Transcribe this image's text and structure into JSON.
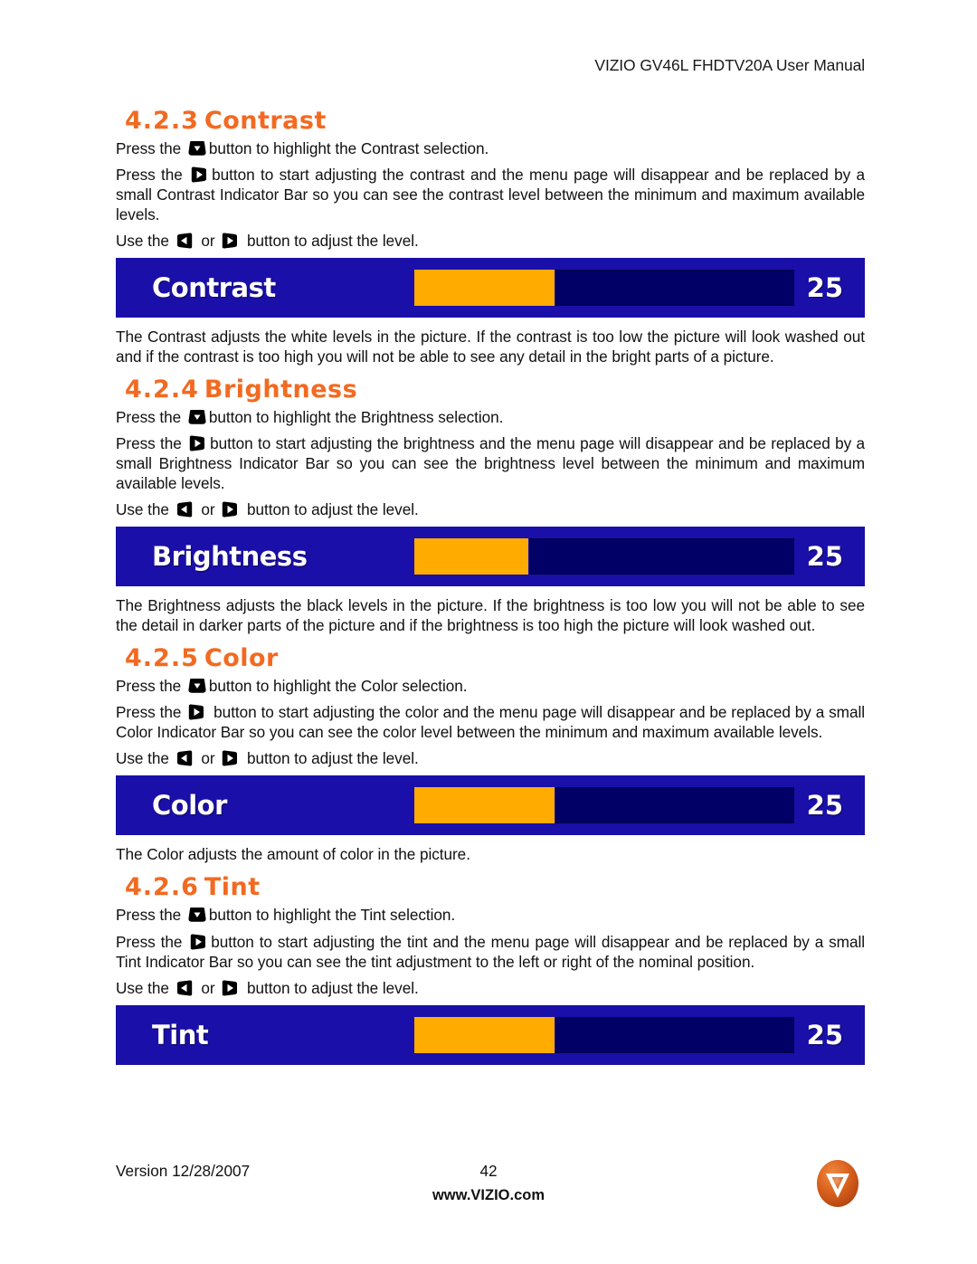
{
  "document": {
    "header": "VIZIO GV46L FHDTV20A User Manual",
    "footer": {
      "version": "Version 12/28/2007",
      "page_number": "42",
      "url": "www.VIZIO.com",
      "logo": "vizio-logo"
    }
  },
  "colors": {
    "heading_orange": "#f26a21",
    "osd_background_blue": "#1a0fa8",
    "osd_track_navy": "#000066",
    "osd_fill_orange": "#ffab00",
    "body_text": "#111111"
  },
  "icons": {
    "down_arrow_key": "down-arrow-button-icon",
    "right_arrow_key": "right-arrow-button-icon",
    "left_arrow_key": "left-arrow-button-icon"
  },
  "sections": [
    {
      "number": "4.2.3",
      "title": "Contrast",
      "paragraphs": [
        {
          "id": "highlight",
          "parts": [
            "Press the ",
            "button to highlight the Contrast selection."
          ],
          "icon": "down-arrow-button-icon",
          "justify": false
        },
        {
          "id": "adjust",
          "parts": [
            "Press the ",
            "button to start adjusting the contrast and the menu page will disappear and be replaced by a small Contrast Indicator Bar so you can see the contrast level between the minimum and maximum available levels."
          ],
          "icon": "right-arrow-button-icon",
          "justify": true
        },
        {
          "id": "use",
          "parts": [
            "Use the ",
            " or ",
            " button to adjust the level."
          ],
          "icons": [
            "left-arrow-button-icon",
            "right-arrow-button-icon"
          ],
          "justify": false
        }
      ],
      "osd": {
        "label": "Contrast",
        "value": "25",
        "fill_percent": 37
      },
      "description": "The Contrast adjusts the white levels in the picture.  If the contrast is too low the picture will look washed out and if the contrast is too high you will not be able to see any detail in the bright parts of a picture."
    },
    {
      "number": "4.2.4",
      "title": "Brightness",
      "paragraphs": [
        {
          "id": "highlight",
          "parts": [
            "Press the ",
            "button to highlight the Brightness selection."
          ],
          "icon": "down-arrow-button-icon",
          "justify": false
        },
        {
          "id": "adjust",
          "parts": [
            "Press the ",
            "button to start adjusting the brightness and the menu page will disappear and be replaced by a small Brightness Indicator Bar so you can see the brightness level between the minimum and maximum available levels."
          ],
          "icon": "right-arrow-button-icon",
          "justify": true
        },
        {
          "id": "use",
          "parts": [
            "Use the ",
            " or ",
            " button to adjust the level."
          ],
          "icons": [
            "left-arrow-button-icon",
            "right-arrow-button-icon"
          ],
          "justify": false
        }
      ],
      "osd": {
        "label": "Brightness",
        "value": "25",
        "fill_percent": 30
      },
      "description": "The Brightness adjusts the black levels in the picture.  If the brightness is too low you will not be able to see the detail in darker parts of the picture and if the brightness is too high the picture will look washed out."
    },
    {
      "number": "4.2.5",
      "title": "Color",
      "paragraphs": [
        {
          "id": "highlight",
          "parts": [
            "Press the ",
            "button to highlight the Color selection."
          ],
          "icon": "down-arrow-button-icon",
          "justify": false
        },
        {
          "id": "adjust",
          "parts": [
            "Press the ",
            " button to start adjusting the color and the menu page will disappear and be replaced by a small Color Indicator Bar so you can see the color level between the minimum and maximum available levels."
          ],
          "icon": "right-arrow-button-icon",
          "justify": true
        },
        {
          "id": "use",
          "parts": [
            "Use the ",
            " or ",
            " button to adjust the level."
          ],
          "icons": [
            "left-arrow-button-icon",
            "right-arrow-button-icon"
          ],
          "justify": false
        }
      ],
      "osd": {
        "label": "Color",
        "value": "25",
        "fill_percent": 37
      },
      "description": "The Color adjusts the amount of color in the picture."
    },
    {
      "number": "4.2.6",
      "title": "Tint",
      "paragraphs": [
        {
          "id": "highlight",
          "parts": [
            "Press the ",
            "button to highlight the Tint selection."
          ],
          "icon": "down-arrow-button-icon",
          "justify": false
        },
        {
          "id": "adjust",
          "parts": [
            "Press the ",
            "button to start adjusting the tint and the menu page will disappear and be replaced by a small Tint Indicator Bar so you can see the tint adjustment to the left or right of the nominal position."
          ],
          "icon": "right-arrow-button-icon",
          "justify": true
        },
        {
          "id": "use",
          "parts": [
            "Use the ",
            " or ",
            " button to adjust the level."
          ],
          "icons": [
            "left-arrow-button-icon",
            "right-arrow-button-icon"
          ],
          "justify": false
        }
      ],
      "osd": {
        "label": "Tint",
        "value": "25",
        "fill_percent": 37
      },
      "description": ""
    }
  ]
}
